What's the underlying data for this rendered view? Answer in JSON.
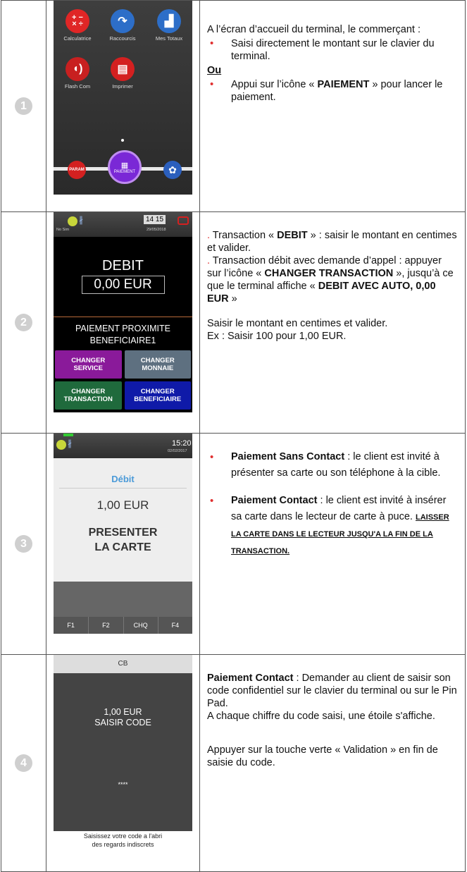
{
  "steps": [
    {
      "number": "1",
      "screen": {
        "apps": [
          {
            "label": "Calculatrice",
            "icon": "calculator-icon",
            "color": "#e02626"
          },
          {
            "label": "Raccourcis",
            "icon": "shortcut-arrow-icon",
            "color": "#2d6ec8"
          },
          {
            "label": "Mes Totaux",
            "icon": "totals-chart-icon",
            "color": "#2d6ec8"
          },
          {
            "label": "Flash Com",
            "icon": "flash-com-icon",
            "color": "#c82020"
          },
          {
            "label": "Imprimer",
            "icon": "printer-icon",
            "color": "#d42020"
          }
        ],
        "param_label": "PARAM",
        "pay_label": "PAIEMENT"
      },
      "text": {
        "intro": "A l’écran d’accueil du terminal, le commerçant :",
        "bullet1": "Saisi directement le montant sur le clavier du terminal.",
        "or": "Ou",
        "bullet2_pre": "Appui sur l’icône « ",
        "bullet2_bold": "PAIEMENT",
        "bullet2_post": " » pour lancer le paiement."
      }
    },
    {
      "number": "2",
      "screen": {
        "nosim": "No Sim",
        "time": "14 15",
        "date": "29/05/2018",
        "title": "DEBIT",
        "amount": "0,00 EUR",
        "line1": "PAIEMENT PROXIMITE",
        "line2": "BENEFICIAIRE1",
        "buttons": [
          {
            "line1": "CHANGER",
            "line2": "SERVICE",
            "color": "#8a1a9a"
          },
          {
            "line1": "CHANGER",
            "line2": "MONNAIE",
            "color": "#5e7080"
          },
          {
            "line1": "CHANGER",
            "line2": "TRANSACTION",
            "color": "#1f6a3c"
          },
          {
            "line1": "CHANGER",
            "line2": "BENEFICIAIRE",
            "color": "#0f1aa8"
          }
        ]
      },
      "text": {
        "p1_pre": " Transaction « ",
        "p1_bold": "DEBIT",
        "p1_post": " » : saisir le montant en centimes et valider.",
        "p2_pre": " Transaction débit avec demande d’appel : appuyer sur l’icône « ",
        "p2_bold1": "CHANGER TRANSACTION",
        "p2_mid": " », jusqu’à ce que le terminal affiche « ",
        "p2_bold2": "DEBIT AVEC AUTO, 0,00 EUR",
        "p2_post": " »",
        "p3": "Saisir le montant en centimes et valider.",
        "p4": "Ex : Saisir 100 pour 1,00 EUR."
      }
    },
    {
      "number": "3",
      "screen": {
        "time": "15:20",
        "date": "02/02/2017",
        "label": "Débit",
        "amount": "1,00 EUR",
        "msg1": "PRESENTER",
        "msg2": "LA CARTE",
        "keys": [
          "F1",
          "F2",
          "CHQ",
          "F4"
        ]
      },
      "text": {
        "b1_bold": "Paiement Sans Contact",
        "b1_rest": " : le client est invité à présenter sa carte ou son téléphone à la cible.",
        "b2_bold": "Paiement Contact",
        "b2_rest": " : le client est invité à insérer sa carte dans le lecteur de carte à puce. ",
        "b2_caps": "LAISSER LA CARTE DANS LE LECTEUR JUSQU'A LA FIN DE LA TRANSACTION."
      }
    },
    {
      "number": "4",
      "screen": {
        "header": "CB",
        "amount": "1,00 EUR",
        "prompt": "SAISIR CODE",
        "stars": "****",
        "note1": "Saisissez votre code a l'abri",
        "note2": "des regards indiscrets"
      },
      "text": {
        "p1_bold": "Paiement Contact",
        "p1_rest": " : Demander au client de saisir son code confidentiel sur le clavier du terminal ou sur le Pin Pad.",
        "p2": "A chaque chiffre du code saisi, une étoile s'affiche.",
        "p3": "Appuyer sur la touche verte « Validation » en fin de saisie du code."
      }
    }
  ]
}
